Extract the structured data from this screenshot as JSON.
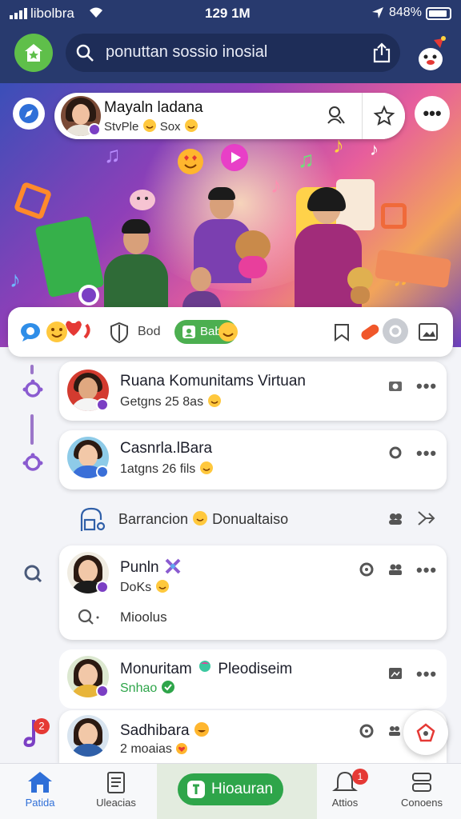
{
  "status_bar": {
    "carrier": "libolbra",
    "time": "129 1M",
    "battery": "848%"
  },
  "header": {
    "search_text": "ponuttan sossio inosial"
  },
  "banner_profile": {
    "name": "Mayaln ladana",
    "subtitle": "StvPle",
    "subtitle_suffix": "Sox"
  },
  "toolbar": {
    "bod_label": "Bod",
    "chip_label": "Bab"
  },
  "feed": [
    {
      "name": "Ruana Komunitams Virtuan",
      "sub": "Getgns 25 8as",
      "badge_color": "#7b3fc4"
    },
    {
      "name": "Casnrla.lBara",
      "sub": "1atgns 26 fils",
      "badge_color": "#3a6fd8"
    },
    {
      "name": "Barrancion",
      "sub": "Donualtaiso"
    },
    {
      "name": "Punln",
      "sub": "DoKs",
      "badge_color": "#7b3fc4",
      "extra": "Mioolus"
    },
    {
      "name": "Monuritam",
      "name_suffix": "Pleodiseim",
      "sub": "Snhao",
      "badge_color": "#2ea54a"
    },
    {
      "name": "Sadhibara",
      "sub": "2 moaias",
      "notif_count": "2"
    }
  ],
  "bottom_nav": {
    "items": [
      {
        "label": "Patida",
        "icon": "home-icon"
      },
      {
        "label": "Uleacias",
        "icon": "document-icon"
      },
      {
        "label": "Hioauran",
        "icon": "chat-icon"
      },
      {
        "label": "Attios",
        "icon": "bell-icon",
        "badge": "1"
      },
      {
        "label": "Conoens",
        "icon": "menu-icon"
      }
    ]
  },
  "colors": {
    "header_bg": "#283a6e",
    "accent_green": "#2ea54a",
    "accent_purple": "#7b3fc4"
  }
}
